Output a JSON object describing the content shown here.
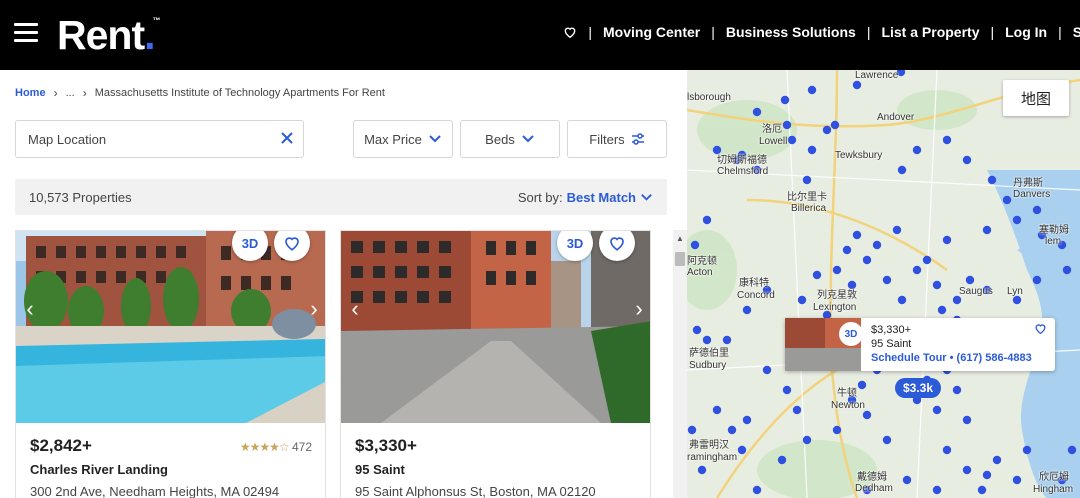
{
  "header": {
    "logo": "Rent",
    "logo_tm": "™",
    "nav": [
      "Moving Center",
      "Business Solutions",
      "List a Property",
      "Log In",
      "Si"
    ]
  },
  "breadcrumb": {
    "home": "Home",
    "ellipsis": "...",
    "current": "Massachusetts Institute of Technology Apartments For Rent"
  },
  "search": {
    "value": "Map Location"
  },
  "filters": {
    "max_price": "Max Price",
    "beds": "Beds",
    "more": "Filters"
  },
  "results": {
    "count": "10,573 Properties",
    "sort_label": "Sort by:",
    "sort_value": "Best Match"
  },
  "listings": [
    {
      "price": "$2,842+",
      "rating_count": "472",
      "rating_stars": "★★★★☆",
      "name": "Charles River Landing",
      "address": "300 2nd Ave, Needham Heights, MA 02494",
      "badge_3d": "3D"
    },
    {
      "price": "$3,330+",
      "name": "95 Saint",
      "address": "95 Saint Alphonsus St, Boston, MA 02120",
      "badge_3d": "3D"
    }
  ],
  "map": {
    "type_button": "地图",
    "popup": {
      "badge_3d": "3D",
      "price": "$3,330+",
      "name": "95 Saint",
      "link": "Schedule Tour • (617) 586-4883"
    },
    "price_pin": "$3.3k",
    "labels": {
      "lawrence": "Lawrence",
      "lsborough": "lsborough",
      "andover": "Andover",
      "lowell": "Lowell",
      "lowell_cn": "洛厄",
      "chelmsford_cn": "切姆斯福德",
      "chelmsford": "Chelmsford",
      "tewksbury": "Tewksbury",
      "billerica_cn": "比尔里卡",
      "billerica": "Billerica",
      "danvers_cn": "丹弗斯",
      "danvers": "Danvers",
      "salem_cn": "塞勒姆",
      "salem": "lem",
      "acton_cn": "阿克顿",
      "acton": "Acton",
      "concord_cn": "康科特",
      "concord": "Concord",
      "lexington_cn": "列克星敦",
      "lexington": "Lexington",
      "saugus": "Saugus",
      "lynn": "Lyn",
      "sudbury_cn": "萨德伯里",
      "sudbury": "Sudbury",
      "newton_cn": "牛顿",
      "newton": "Newton",
      "framingham_cn": "弗雷明汉",
      "framingham": "ramingham",
      "dedham_cn": "戴德姆",
      "dedham": "Dedham",
      "hingham_cn": "欣厄姆",
      "hingham": "Hingham"
    }
  }
}
